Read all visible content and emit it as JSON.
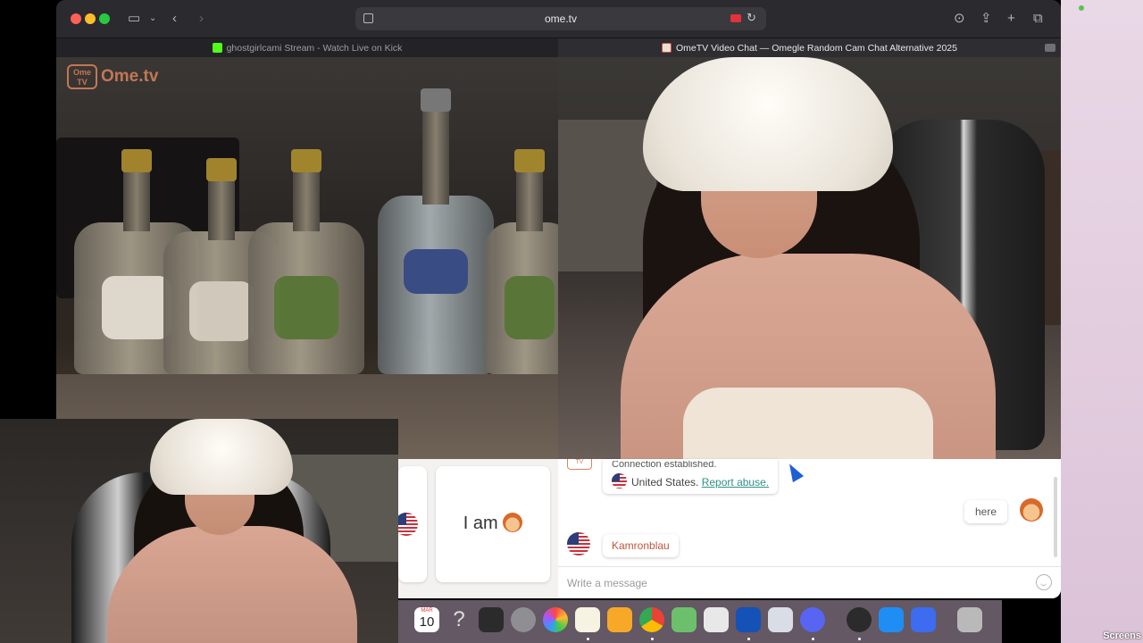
{
  "browser": {
    "url": "ome.tv",
    "tabs": [
      {
        "label": "ghostgirlcami Stream - Watch Live on Kick",
        "active": false
      },
      {
        "label": "OmeTV Video Chat — Omegle Random Cam Chat Alternative 2025",
        "active": true
      }
    ]
  },
  "video": {
    "logo_top": "Ome",
    "logo_bottom": "TV",
    "logo_text": "Ome.tv"
  },
  "chat": {
    "quick_reply": "I am",
    "system_message": "Connection established.",
    "location": "United States.",
    "report_link": "Report abuse.",
    "my_message": "here",
    "partner_message": "Kamronblau",
    "input_placeholder": "Write a message"
  },
  "dock": {
    "calendar_month": "MAR",
    "calendar_day": "10"
  },
  "desktop": {
    "screenshots_label": "Screens"
  },
  "colors": {
    "accent_orange": "#d9835e",
    "report_link": "#2f8f8a",
    "partner_name": "#c0553f"
  }
}
